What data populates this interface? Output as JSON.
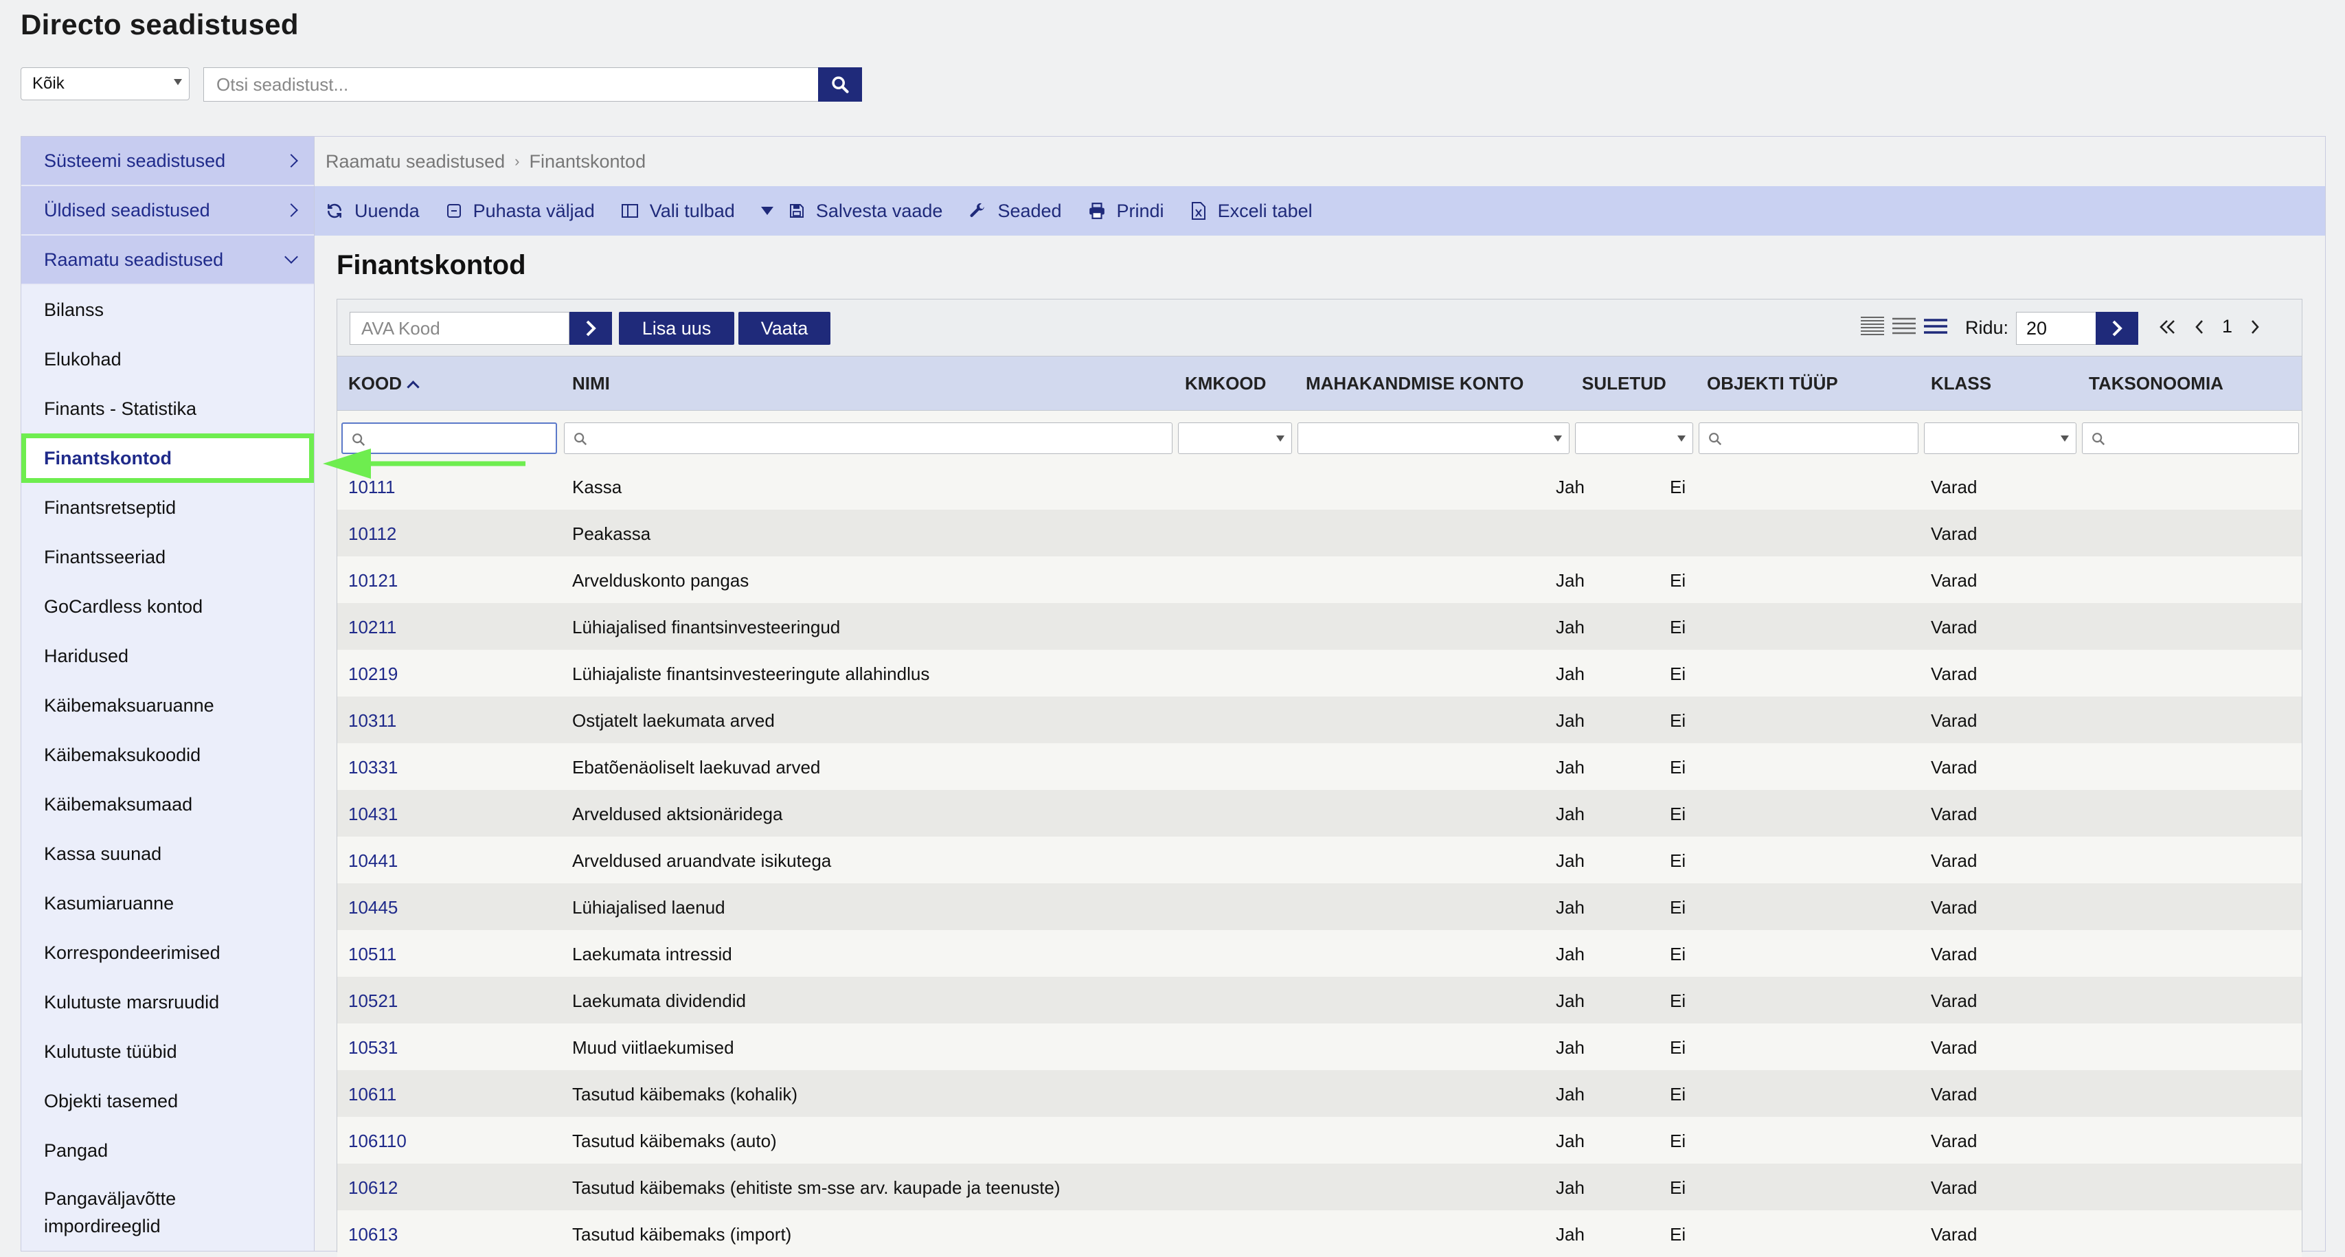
{
  "header": {
    "title": "Directo seadistused",
    "scope_value": "Kõik",
    "search_placeholder": "Otsi seadistust..."
  },
  "sidebar": {
    "sections": [
      {
        "label": "Süsteemi seadistused"
      },
      {
        "label": "Üldised seadistused"
      },
      {
        "label": "Raamatu seadistused"
      }
    ],
    "items": [
      {
        "label": "Bilanss"
      },
      {
        "label": "Elukohad"
      },
      {
        "label": "Finants - Statistika"
      },
      {
        "label": "Finantskontod"
      },
      {
        "label": "Finantsretseptid"
      },
      {
        "label": "Finantsseeriad"
      },
      {
        "label": "GoCardless kontod"
      },
      {
        "label": "Haridused"
      },
      {
        "label": "Käibemaksuaruanne"
      },
      {
        "label": "Käibemaksukoodid"
      },
      {
        "label": "Käibemaksumaad"
      },
      {
        "label": "Kassa suunad"
      },
      {
        "label": "Kasumiaruanne"
      },
      {
        "label": "Korrespondeerimised"
      },
      {
        "label": "Kulutuste marsruudid"
      },
      {
        "label": "Kulutuste tüübid"
      },
      {
        "label": "Objekti tasemed"
      },
      {
        "label": "Pangad"
      },
      {
        "label": "Pangaväljavõtte impordireeglid"
      }
    ]
  },
  "breadcrumb": {
    "parent": "Raamatu seadistused",
    "current": "Finantskontod"
  },
  "toolbar": {
    "refresh": "Uuenda",
    "clear": "Puhasta väljad",
    "columns": "Vali tulbad",
    "save_view": "Salvesta vaade",
    "settings": "Seaded",
    "print": "Prindi",
    "excel": "Exceli tabel"
  },
  "main": {
    "title": "Finantskontod",
    "ava_placeholder": "AVA Kood",
    "add_new": "Lisa uus",
    "view": "Vaata",
    "rows_label": "Ridu:",
    "rows_value": "20",
    "page": "1"
  },
  "table": {
    "headers": {
      "kood": "KOOD",
      "nimi": "NIMI",
      "kmkood": "KMKOOD",
      "mahakandmise": "MAHAKANDMISE KONTO",
      "suletud": "SULETUD",
      "objekti": "OBJEKTI TÜÜP",
      "klass": "KLASS",
      "taksonoomia": "TAKSONOOMIA"
    },
    "rows": [
      {
        "kood": "10111",
        "nimi": "Kassa",
        "mahakandmise": "Jah",
        "suletud": "Ei",
        "klass": "Varad"
      },
      {
        "kood": "10112",
        "nimi": "Peakassa",
        "mahakandmise": "",
        "suletud": "",
        "klass": "Varad"
      },
      {
        "kood": "10121",
        "nimi": "Arvelduskonto pangas",
        "mahakandmise": "Jah",
        "suletud": "Ei",
        "klass": "Varad"
      },
      {
        "kood": "10211",
        "nimi": "Lühiajalised finantsinvesteeringud",
        "mahakandmise": "Jah",
        "suletud": "Ei",
        "klass": "Varad"
      },
      {
        "kood": "10219",
        "nimi": "Lühiajaliste finantsinvesteeringute allahindlus",
        "mahakandmise": "Jah",
        "suletud": "Ei",
        "klass": "Varad"
      },
      {
        "kood": "10311",
        "nimi": "Ostjatelt laekumata arved",
        "mahakandmise": "Jah",
        "suletud": "Ei",
        "klass": "Varad"
      },
      {
        "kood": "10331",
        "nimi": "Ebatõenäoliselt laekuvad arved",
        "mahakandmise": "Jah",
        "suletud": "Ei",
        "klass": "Varad"
      },
      {
        "kood": "10431",
        "nimi": "Arveldused aktsionäridega",
        "mahakandmise": "Jah",
        "suletud": "Ei",
        "klass": "Varad"
      },
      {
        "kood": "10441",
        "nimi": "Arveldused aruandvate isikutega",
        "mahakandmise": "Jah",
        "suletud": "Ei",
        "klass": "Varad"
      },
      {
        "kood": "10445",
        "nimi": "Lühiajalised laenud",
        "mahakandmise": "Jah",
        "suletud": "Ei",
        "klass": "Varad"
      },
      {
        "kood": "10511",
        "nimi": "Laekumata intressid",
        "mahakandmise": "Jah",
        "suletud": "Ei",
        "klass": "Varad"
      },
      {
        "kood": "10521",
        "nimi": "Laekumata dividendid",
        "mahakandmise": "Jah",
        "suletud": "Ei",
        "klass": "Varad"
      },
      {
        "kood": "10531",
        "nimi": "Muud viitlaekumised",
        "mahakandmise": "Jah",
        "suletud": "Ei",
        "klass": "Varad"
      },
      {
        "kood": "10611",
        "nimi": "Tasutud käibemaks (kohalik)",
        "mahakandmise": "Jah",
        "suletud": "Ei",
        "klass": "Varad"
      },
      {
        "kood": "106110",
        "nimi": "Tasutud käibemaks (auto)",
        "mahakandmise": "Jah",
        "suletud": "Ei",
        "klass": "Varad"
      },
      {
        "kood": "10612",
        "nimi": "Tasutud käibemaks (ehitiste sm-sse arv. kaupade ja teenuste)",
        "mahakandmise": "Jah",
        "suletud": "Ei",
        "klass": "Varad"
      },
      {
        "kood": "10613",
        "nimi": "Tasutud käibemaks (import)",
        "mahakandmise": "Jah",
        "suletud": "Ei",
        "klass": "Varad"
      }
    ]
  },
  "colors": {
    "accent": "#1f2a7a",
    "highlight": "#6eed4f",
    "toolbar_bg": "#c9d1f2",
    "sidebar_section_bg": "#c7ccf0"
  }
}
